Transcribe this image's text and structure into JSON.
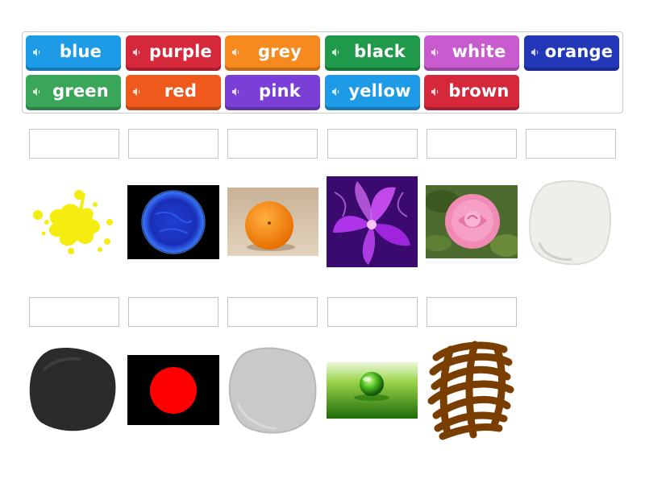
{
  "word_tiles": [
    {
      "label": "blue",
      "color": "#1e9be6"
    },
    {
      "label": "purple",
      "color": "#d6283b"
    },
    {
      "label": "grey",
      "color": "#f68a1e"
    },
    {
      "label": "black",
      "color": "#1f9a4a"
    },
    {
      "label": "white",
      "color": "#c85ccf"
    },
    {
      "label": "orange",
      "color": "#2238b8"
    },
    {
      "label": "green",
      "color": "#3aa65a"
    },
    {
      "label": "red",
      "color": "#ef5a1c"
    },
    {
      "label": "pink",
      "color": "#7a3fd6"
    },
    {
      "label": "yellow",
      "color": "#1e9be6"
    },
    {
      "label": "brown",
      "color": "#d6283b"
    }
  ],
  "image_items": [
    {
      "subject": "yellow paint splash"
    },
    {
      "subject": "blue sun"
    },
    {
      "subject": "orange fruit"
    },
    {
      "subject": "purple flower smoke"
    },
    {
      "subject": "pink rose"
    },
    {
      "subject": "white paint blob"
    },
    {
      "subject": "black paint blob"
    },
    {
      "subject": "red circle on black"
    },
    {
      "subject": "grey paint blob"
    },
    {
      "subject": "green glass ball"
    },
    {
      "subject": "brown scribble"
    }
  ],
  "icons": {
    "tile_audio": "speaker-icon"
  }
}
